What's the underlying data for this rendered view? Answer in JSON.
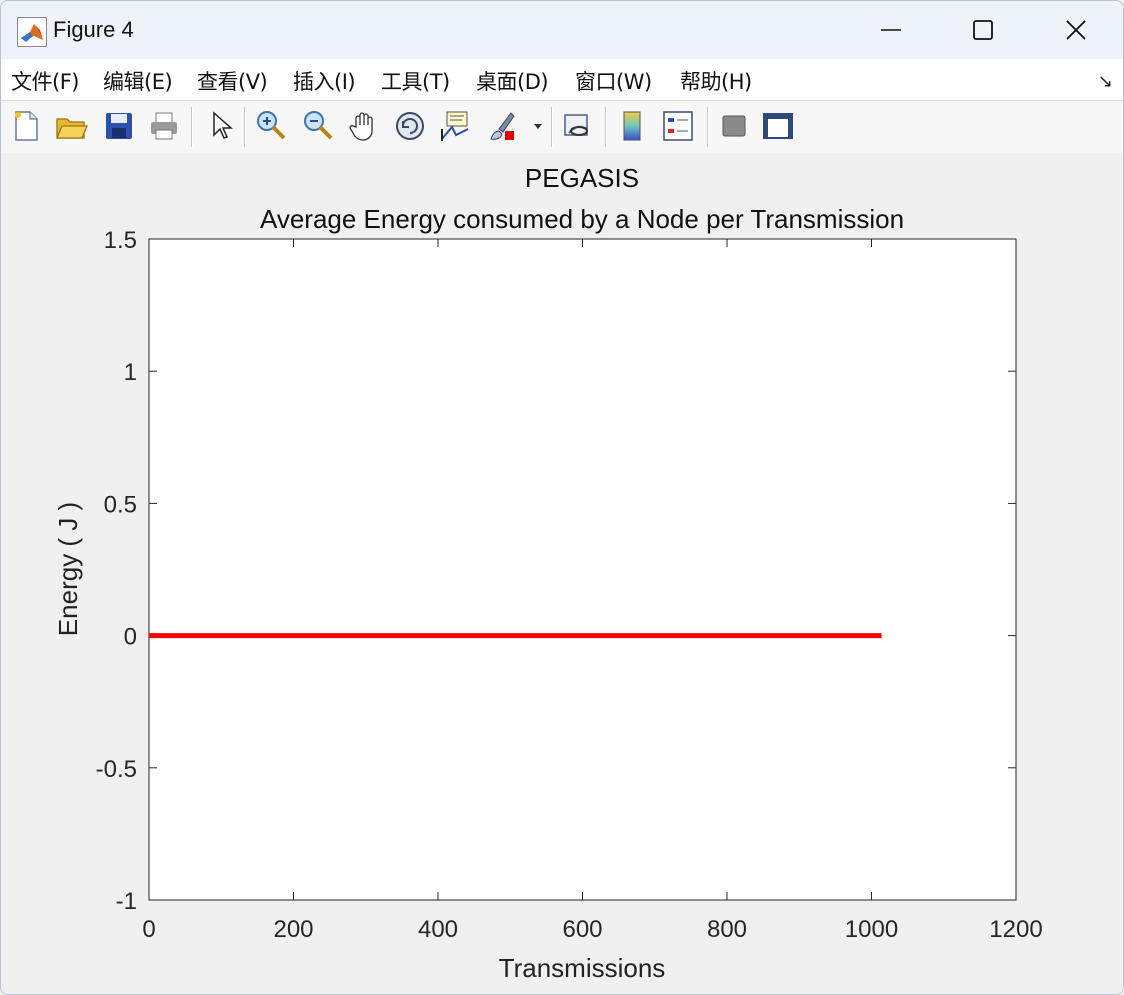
{
  "window": {
    "title": "Figure 4"
  },
  "menu": {
    "items": [
      "文件(F)",
      "编辑(E)",
      "查看(V)",
      "插入(I)",
      "工具(T)",
      "桌面(D)",
      "窗口(W)",
      "帮助(H)"
    ],
    "dock_arrow": "↘"
  },
  "toolbar": {
    "icons": [
      "new-figure-icon",
      "open-file-icon",
      "save-icon",
      "print-icon",
      "select-arrow-icon",
      "zoom-in-icon",
      "zoom-out-icon",
      "pan-hand-icon",
      "rotate-3d-icon",
      "data-cursor-icon",
      "brush-icon",
      "link-plot-icon",
      "colorbar-icon",
      "legend-icon",
      "hide-plot-tools-icon",
      "show-plot-tools-icon"
    ]
  },
  "chart_data": {
    "type": "line",
    "title": "PEGASIS",
    "subtitle": "Average Energy consumed by a Node per Transmission",
    "xlabel": "Transmissions",
    "ylabel": "Energy ( J )",
    "xlim": [
      0,
      1200
    ],
    "ylim": [
      -1,
      1.5
    ],
    "xticks": [
      0,
      200,
      400,
      600,
      800,
      1000,
      1200
    ],
    "yticks": [
      -1,
      -0.5,
      0,
      0.5,
      1,
      1.5
    ],
    "xtick_labels": [
      "0",
      "200",
      "400",
      "600",
      "800",
      "1000",
      "1200"
    ],
    "ytick_labels": [
      "-1",
      "-0.5",
      "0",
      "0.5",
      "1",
      "1.5"
    ],
    "grid": false,
    "series": [
      {
        "color": "#ff0000",
        "x": [
          0,
          1014
        ],
        "y": [
          0,
          0
        ]
      }
    ]
  }
}
